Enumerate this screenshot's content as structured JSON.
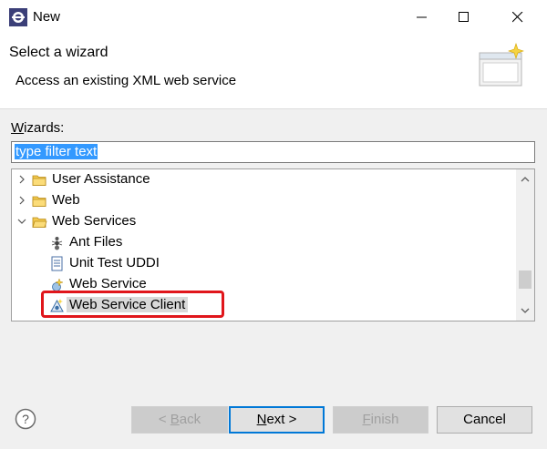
{
  "window": {
    "title": "New",
    "icons": {
      "app": "eclipse-icon",
      "minimize": "minimize-icon",
      "maximize": "maximize-icon",
      "close": "close-icon"
    }
  },
  "header": {
    "title": "Select a wizard",
    "description": "Access an existing XML web service",
    "image_icon": "new-wizard-banner-icon"
  },
  "wizards": {
    "label_mnemonic": "W",
    "label_rest": "izards:",
    "filter_value": "type filter text"
  },
  "tree": {
    "items": [
      {
        "label": "User Assistance",
        "icon": "folder-icon",
        "expanded": false
      },
      {
        "label": "Web",
        "icon": "folder-icon",
        "expanded": false
      },
      {
        "label": "Web Services",
        "icon": "folder-icon",
        "expanded": true
      },
      {
        "label": "Ant Files",
        "icon": "ant-icon"
      },
      {
        "label": "Unit Test UDDI",
        "icon": "document-icon"
      },
      {
        "label": "Web Service",
        "icon": "web-service-icon"
      },
      {
        "label": "Web Service Client",
        "icon": "web-service-client-icon",
        "selected": true
      }
    ]
  },
  "buttons": {
    "back_mnemonic": "B",
    "back_prefix": "< ",
    "back_rest": "ack",
    "next_mnemonic": "N",
    "next_rest": "ext >",
    "finish_mnemonic": "F",
    "finish_rest": "inish",
    "cancel": "Cancel"
  },
  "colors": {
    "highlight_border": "#e0161b",
    "selection": "#3399ff",
    "default_button_border": "#0078d7"
  }
}
